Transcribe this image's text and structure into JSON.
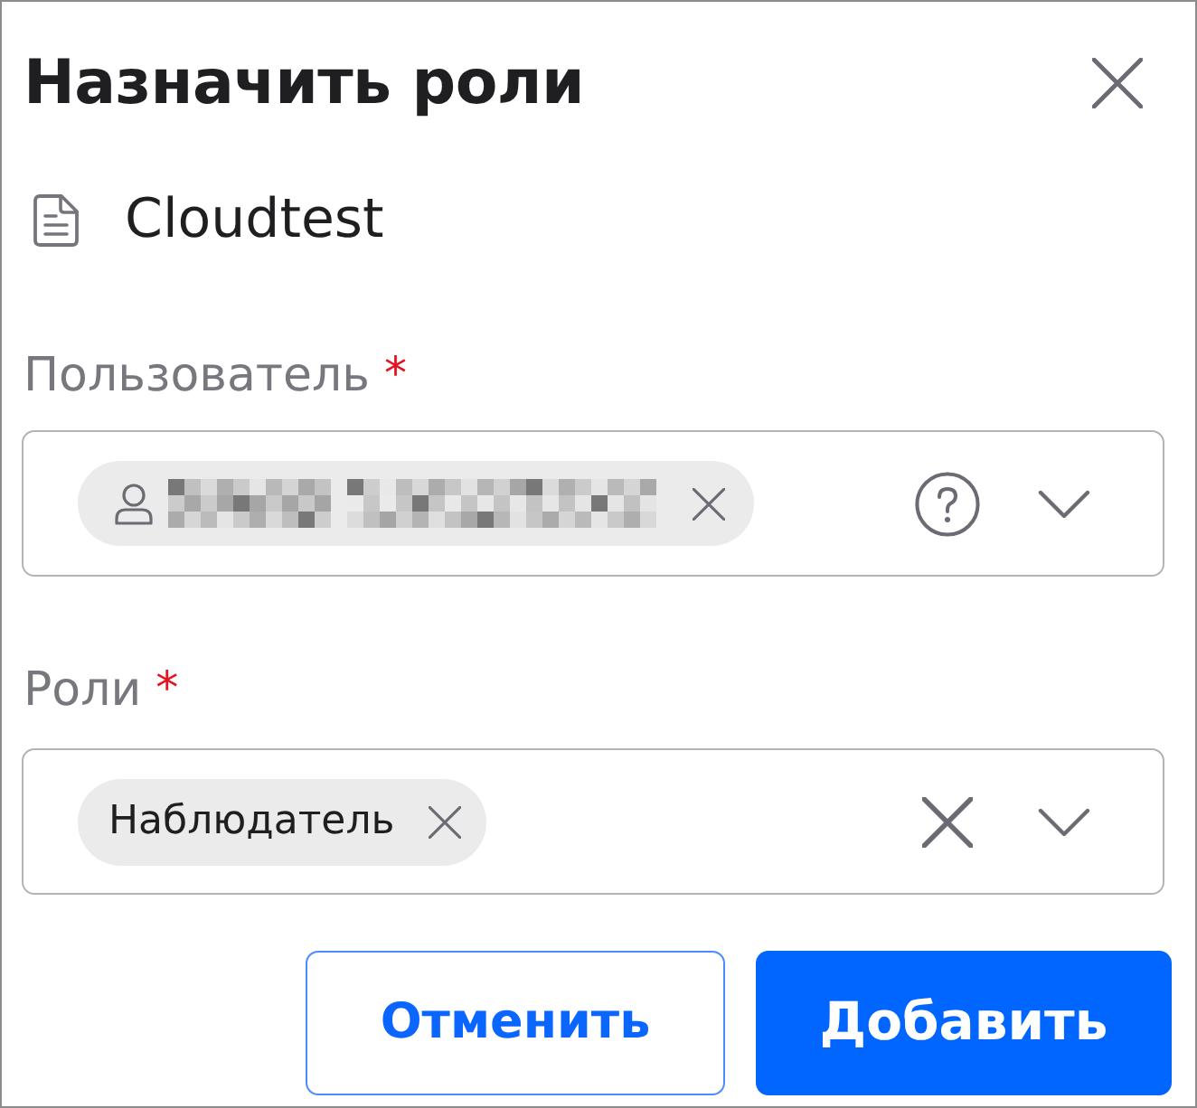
{
  "title": "Назначить роли",
  "resource": {
    "name": "Cloudtest"
  },
  "fields": [
    {
      "label": "Пользователь",
      "required_mark": "*",
      "chips": [
        {
          "kind": "user",
          "redacted": true
        }
      ],
      "actions": [
        {
          "kind": "help"
        },
        {
          "kind": "expand"
        }
      ]
    },
    {
      "label": "Роли",
      "required_mark": "*",
      "chips": [
        {
          "kind": "text",
          "label": "Наблюдатель"
        }
      ],
      "actions": [
        {
          "kind": "clear"
        },
        {
          "kind": "expand"
        }
      ]
    }
  ],
  "buttons": [
    {
      "label": "Отменить",
      "kind": "secondary"
    },
    {
      "label": "Добавить",
      "kind": "primary"
    }
  ]
}
